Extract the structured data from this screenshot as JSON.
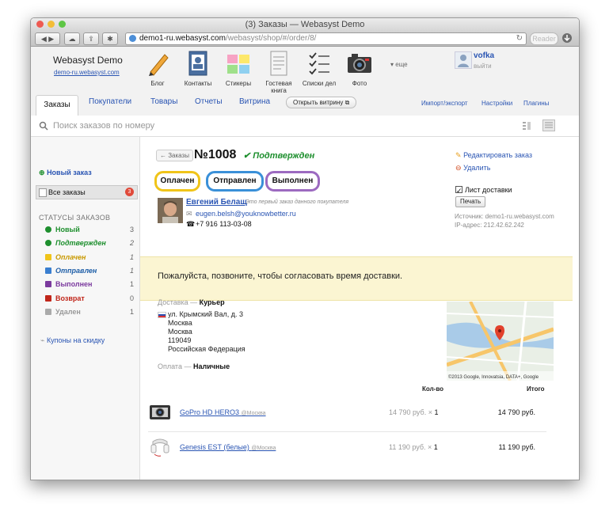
{
  "window": {
    "title": "(3) Заказы — Webasyst Demo"
  },
  "browser": {
    "url_host": "demo1-ru.webasyst.com",
    "url_path": "/webasyst/shop/#/order/8/",
    "reader_label": "Reader"
  },
  "header": {
    "brand": "Webasyst Demo",
    "brand_link": "demo-ru.webasyst.com",
    "apps": [
      "Блог",
      "Контакты",
      "Стикеры",
      "Гостевая книга",
      "Списки дел",
      "Фото"
    ],
    "more_label": "▾ еще",
    "user_name": "vofka",
    "logout": "выйти"
  },
  "nav": {
    "tabs": [
      "Заказы",
      "Покупатели",
      "Товары",
      "Отчеты",
      "Витрина"
    ],
    "storefront_button": "Открыть витрину",
    "right_links": [
      "Импорт/экспорт",
      "Настройки",
      "Плагины"
    ]
  },
  "search": {
    "placeholder": "Поиск заказов по номеру"
  },
  "sidebar": {
    "new_order": "Новый заказ",
    "all_orders": "Все заказы",
    "all_orders_count": "3",
    "statuses_heading": "СТАТУСЫ ЗАКАЗОВ",
    "statuses": [
      {
        "label": "Новый",
        "count": "3",
        "color": "#1e8f2e"
      },
      {
        "label": "Подтвержден",
        "count": "2",
        "color": "#1e8f2e"
      },
      {
        "label": "Оплачен",
        "count": "1",
        "color": "#c99a00"
      },
      {
        "label": "Отправлен",
        "count": "1",
        "color": "#1f5fa8"
      },
      {
        "label": "Выполнен",
        "count": "1",
        "color": "#7b3a9e"
      },
      {
        "label": "Возврат",
        "count": "0",
        "color": "#c0261a"
      },
      {
        "label": "Удален",
        "count": "1",
        "color": "#999999"
      }
    ],
    "coupons": "Купоны на скидку"
  },
  "order": {
    "back_label": "← Заказы",
    "number": "№1008",
    "status": "Подтвержден",
    "actions": [
      "Оплачен",
      "Отправлен",
      "Выполнен"
    ],
    "customer_name": "Евгений Белащ",
    "customer_note": "Это первый заказ данного покупателя",
    "email": "eugen.belsh@youknowbetter.ru",
    "phone": "+7 916 113-03-08",
    "edit_label": "Редактировать заказ",
    "delete_label": "Удалить",
    "packing_list_label": "Лист доставки",
    "print_label": "Печать",
    "source_label": "Источник: demo1-ru.webasyst.com",
    "ip_label": "IP-адрес: 212.42.62.242",
    "comment": "Пожалуйста, позвоните, чтобы согласовать время доставки.",
    "shipping_label": "Доставка —",
    "shipping_method": "Курьер",
    "address_lines": [
      "ул. Крымский Вал, д. 3",
      "Москва",
      "Москва",
      "119049",
      "Российская Федерация"
    ],
    "payment_label": "Оплата —",
    "payment_method": "Наличные",
    "map_caption": "©2013 Google, Innovatsia, DATA+, Google",
    "qty_header": "Кол-во",
    "total_header": "Итого",
    "items": [
      {
        "name": "GoPro HD HERO3",
        "location": "@Москва",
        "price": "14 790 руб. ×",
        "qty": "1",
        "total": "14 790 руб."
      },
      {
        "name": "Genesis EST (белые)",
        "location": "@Москва",
        "price": "11 190 руб. ×",
        "qty": "1",
        "total": "11 190 руб."
      }
    ]
  }
}
